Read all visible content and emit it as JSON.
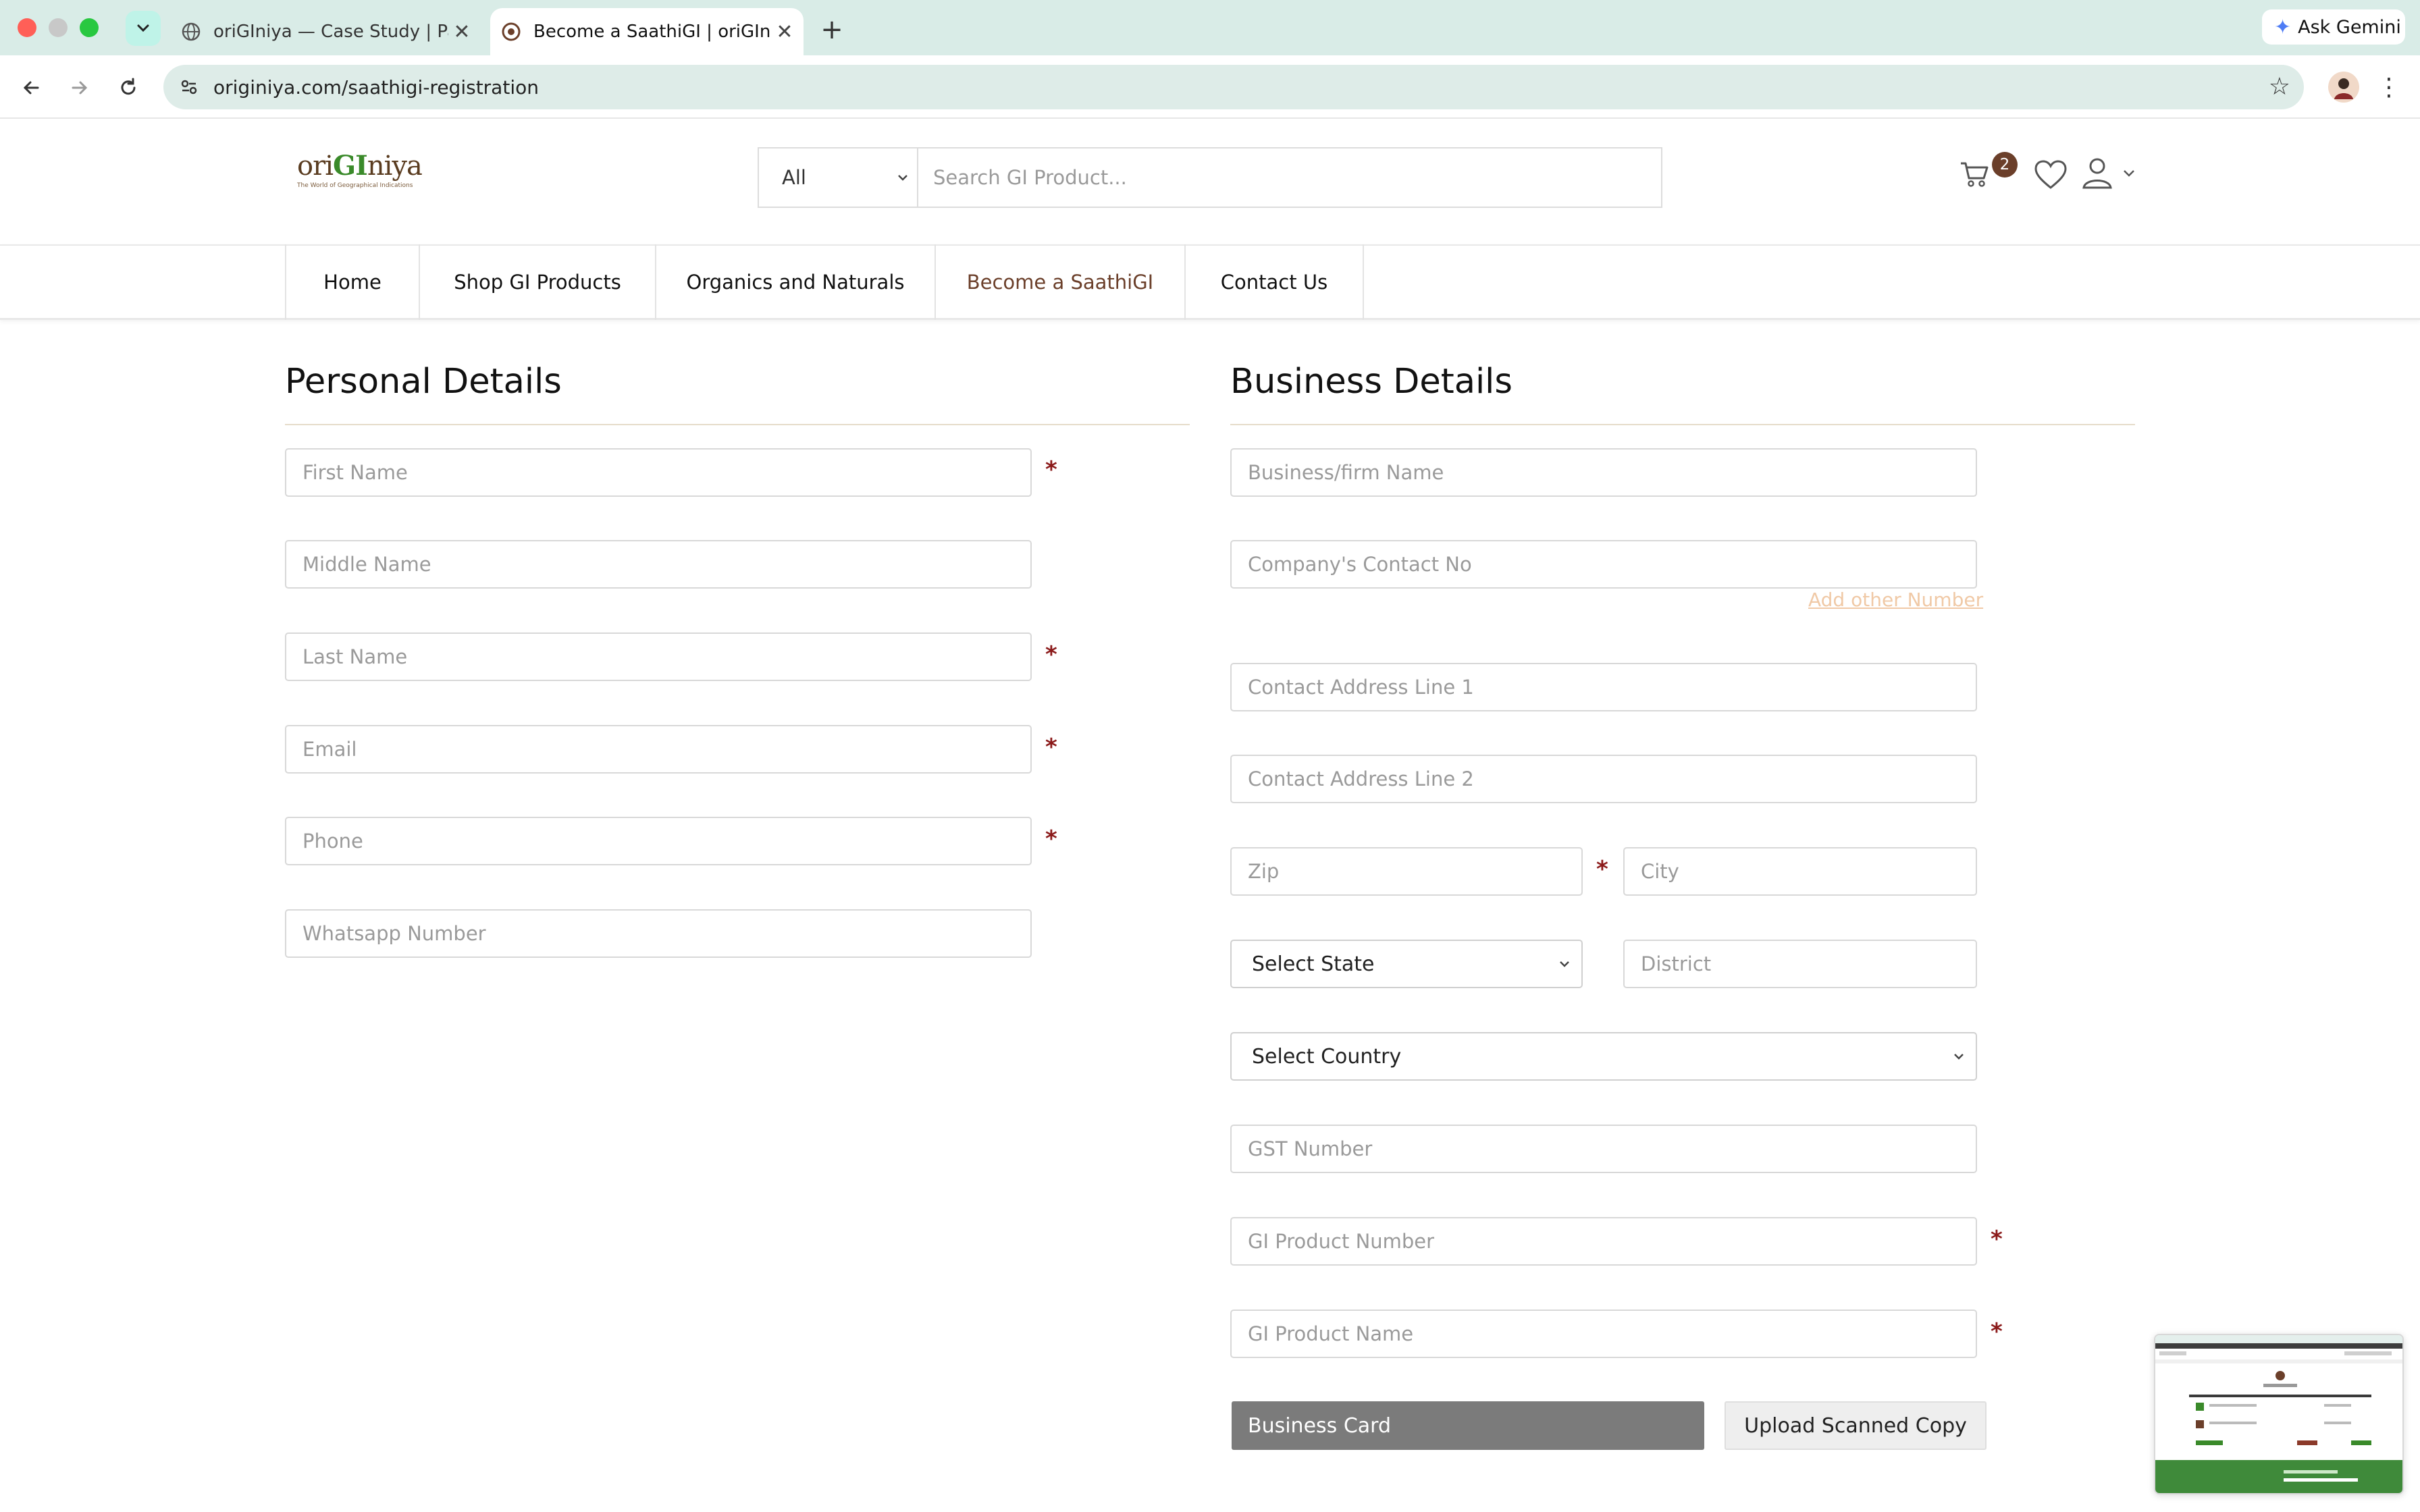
{
  "browser": {
    "tabs": [
      {
        "title": "oriGIniya — Case Study | Para",
        "favicon": "globe-icon",
        "active": false
      },
      {
        "title": "Become a SaathiGI | oriGIniya",
        "favicon": "originiya-favicon",
        "active": true
      }
    ],
    "new_tab_label": "+",
    "ask_gemini_label": "Ask Gemini",
    "url": "originiya.com/saathigi-registration"
  },
  "site": {
    "logo": {
      "prefix": "ori",
      "highlight": "GI",
      "suffix": "niya",
      "tagline": "The World of Geographical Indications"
    },
    "search": {
      "category": "All",
      "placeholder": "Search GI Product..."
    },
    "cart_count": "2",
    "nav": [
      "Home",
      "Shop GI Products",
      "Organics and Naturals",
      "Become a SaathiGI",
      "Contact Us"
    ],
    "active_nav": "Become a SaathiGI"
  },
  "form": {
    "personal_title": "Personal Details",
    "business_title": "Business Details",
    "personal_fields": [
      {
        "placeholder": "First Name",
        "required": true
      },
      {
        "placeholder": "Middle Name",
        "required": false
      },
      {
        "placeholder": "Last Name",
        "required": true
      },
      {
        "placeholder": "Email",
        "required": true
      },
      {
        "placeholder": "Phone",
        "required": true
      },
      {
        "placeholder": "Whatsapp Number",
        "required": false
      }
    ],
    "business": {
      "firm_name": "Business/firm Name",
      "contact_no": "Company's Contact No",
      "add_other_number": "Add other Number",
      "address_line1": "Contact Address Line 1",
      "address_line2": "Contact Address Line 2",
      "zip": "Zip",
      "city": "City",
      "state_select": "Select State",
      "district": "District",
      "country_select": "Select Country",
      "gst": "GST Number",
      "gi_product_number": "GI Product Number",
      "gi_product_name": "GI Product Name",
      "business_card_label": "Business Card",
      "upload_label": "Upload Scanned Copy"
    },
    "required_mark": "*"
  },
  "colors": {
    "brand_brown": "#6b3f2a",
    "brand_green": "#3a8a2a",
    "required_red": "#8b1a1a",
    "chrome_bg": "#d9ece7"
  }
}
